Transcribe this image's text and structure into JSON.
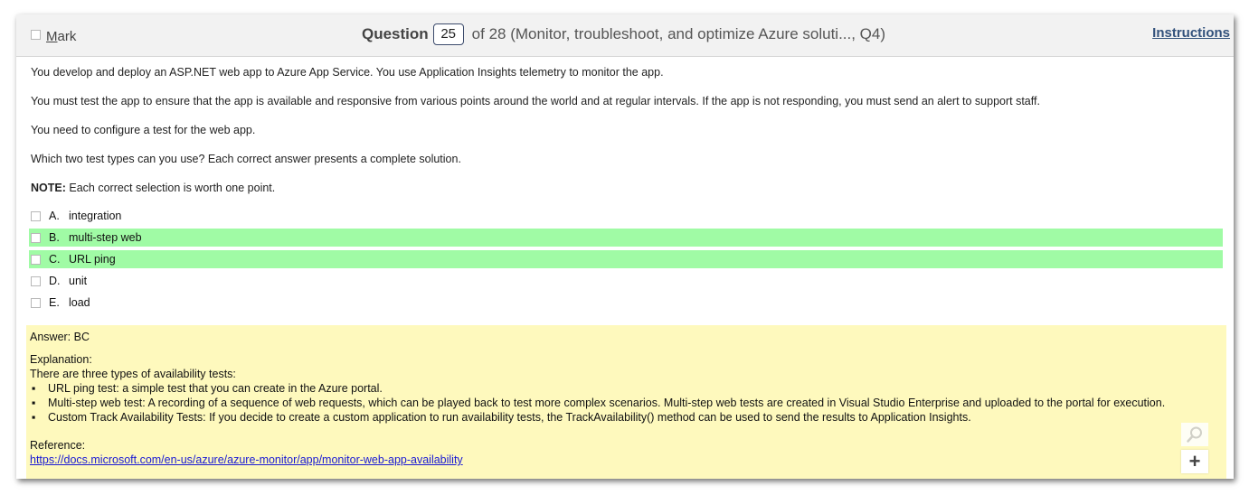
{
  "header": {
    "mark_underlined": "M",
    "mark_rest": "ark",
    "question_word": "Question",
    "question_number": "25",
    "question_suffix": "of 28 (Monitor, troubleshoot, and optimize Azure soluti..., Q4)",
    "instructions_label": "Instructions"
  },
  "question": {
    "paragraphs": [
      "You develop and deploy an ASP.NET web app to Azure App Service. You use Application Insights telemetry to monitor the app.",
      "You must test the app to ensure that the app is available and responsive from various points around the world and at regular intervals. If the app is not responding, you must send an alert to support staff.",
      "You need to configure a test for the web app.",
      "Which two test types can you use? Each correct answer presents a complete solution."
    ],
    "note_label": "NOTE:",
    "note_text": " Each correct selection is worth one point."
  },
  "options": [
    {
      "letter": "A.",
      "text": "integration",
      "highlighted": false
    },
    {
      "letter": "B.",
      "text": "multi-step web",
      "highlighted": true
    },
    {
      "letter": "C.",
      "text": "URL ping",
      "highlighted": true
    },
    {
      "letter": "D.",
      "text": "unit",
      "highlighted": false
    },
    {
      "letter": "E.",
      "text": "load",
      "highlighted": false
    }
  ],
  "answer": {
    "answer_line": "Answer: BC",
    "explanation_label": "Explanation:",
    "intro": "There are three types of availability tests:",
    "bullets": [
      "URL ping test: a simple test that you can create in the Azure portal.",
      "Multi-step web test: A recording of a sequence of web requests, which can be played back to test more complex scenarios. Multi-step web tests are created in Visual Studio Enterprise and uploaded to the portal for execution.",
      "Custom Track Availability Tests: If you decide to create a custom application to run availability tests, the TrackAvailability() method can be used to send the results to Application Insights."
    ],
    "bullet_char": "▪",
    "reference_label": "Reference:",
    "reference_url": "https://docs.microsoft.com/en-us/azure/azure-monitor/app/monitor-web-app-availability"
  },
  "zoom": {
    "zoom_in_label": "+"
  },
  "colors": {
    "highlight": "#a0fba5",
    "answer_bg": "#fef9bd",
    "link": "#1a1ad4",
    "instructions": "#33527c"
  }
}
